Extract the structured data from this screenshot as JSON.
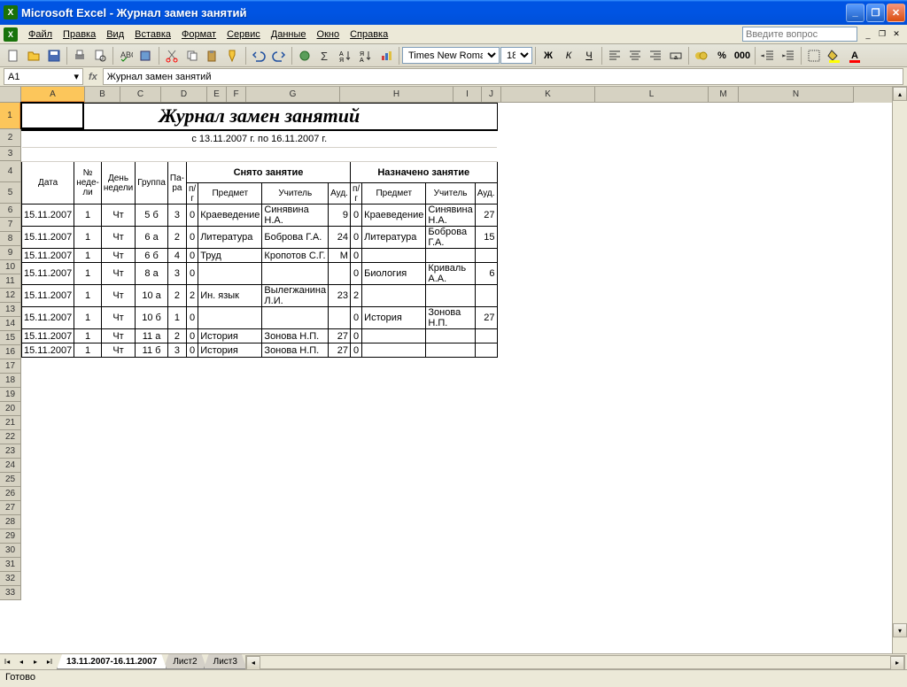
{
  "app": {
    "name": "Microsoft Excel",
    "doc": "Журнал замен занятий",
    "titlebar": "Microsoft Excel - Журнал замен занятий"
  },
  "menus": [
    "Файл",
    "Правка",
    "Вид",
    "Вставка",
    "Формат",
    "Сервис",
    "Данные",
    "Окно",
    "Справка"
  ],
  "question_placeholder": "Введите вопрос",
  "font": {
    "name": "Times New Roman",
    "size": "18"
  },
  "namebox": "A1",
  "formula": "Журнал замен занятий",
  "columns": [
    "A",
    "B",
    "C",
    "D",
    "E",
    "F",
    "G",
    "H",
    "I",
    "J",
    "K",
    "L",
    "M",
    "N"
  ],
  "content": {
    "title": "Журнал замен занятий",
    "subtitle": "с 13.11.2007 г. по 16.11.2007 г.",
    "section_removed": "Снято занятие",
    "section_assigned": "Назначено занятие",
    "headers": {
      "date": "Дата",
      "weeknum": "№ неде-ли",
      "weekday": "День недели",
      "group": "Группа",
      "pair": "Па-ра",
      "pg": "п/г",
      "subject": "Предмет",
      "teacher": "Учитель",
      "aud": "Ауд."
    },
    "rows": [
      {
        "date": "15.11.2007",
        "wn": "1",
        "wd": "Чт",
        "grp": "5 б",
        "pr": "3",
        "pg1": "0",
        "subj1": "Краеведение",
        "tch1": "Синявина Н.А.",
        "aud1": "9",
        "pg2": "0",
        "subj2": "Краеведение",
        "tch2": "Синявина Н.А.",
        "aud2": "27"
      },
      {
        "date": "15.11.2007",
        "wn": "1",
        "wd": "Чт",
        "grp": "6 а",
        "pr": "2",
        "pg1": "0",
        "subj1": "Литература",
        "tch1": "Боброва Г.А.",
        "aud1": "24",
        "pg2": "0",
        "subj2": "Литература",
        "tch2": "Боброва Г.А.",
        "aud2": "15"
      },
      {
        "date": "15.11.2007",
        "wn": "1",
        "wd": "Чт",
        "grp": "6 б",
        "pr": "4",
        "pg1": "0",
        "subj1": "Труд",
        "tch1": "Кропотов С.Г.",
        "aud1": "М",
        "pg2": "0",
        "subj2": "",
        "tch2": "",
        "aud2": ""
      },
      {
        "date": "15.11.2007",
        "wn": "1",
        "wd": "Чт",
        "grp": "8 а",
        "pr": "3",
        "pg1": "0",
        "subj1": "",
        "tch1": "",
        "aud1": "",
        "pg2": "0",
        "subj2": "Биология",
        "tch2": "Криваль А.А.",
        "aud2": "6"
      },
      {
        "date": "15.11.2007",
        "wn": "1",
        "wd": "Чт",
        "grp": "10 а",
        "pr": "2",
        "pg1": "2",
        "subj1": "Ин. язык",
        "tch1": "Вылегжанина Л.И.",
        "aud1": "23",
        "pg2": "2",
        "subj2": "",
        "tch2": "",
        "aud2": ""
      },
      {
        "date": "15.11.2007",
        "wn": "1",
        "wd": "Чт",
        "grp": "10 б",
        "pr": "1",
        "pg1": "0",
        "subj1": "",
        "tch1": "",
        "aud1": "",
        "pg2": "0",
        "subj2": "История",
        "tch2": "Зонова Н.П.",
        "aud2": "27"
      },
      {
        "date": "15.11.2007",
        "wn": "1",
        "wd": "Чт",
        "grp": "11 а",
        "pr": "2",
        "pg1": "0",
        "subj1": "История",
        "tch1": "Зонова Н.П.",
        "aud1": "27",
        "pg2": "0",
        "subj2": "",
        "tch2": "",
        "aud2": ""
      },
      {
        "date": "15.11.2007",
        "wn": "1",
        "wd": "Чт",
        "grp": "11 б",
        "pr": "3",
        "pg1": "0",
        "subj1": "История",
        "tch1": "Зонова Н.П.",
        "aud1": "27",
        "pg2": "0",
        "subj2": "",
        "tch2": "",
        "aud2": ""
      }
    ]
  },
  "sheets": [
    "13.11.2007-16.11.2007",
    "Лист2",
    "Лист3"
  ],
  "status": "Готово"
}
